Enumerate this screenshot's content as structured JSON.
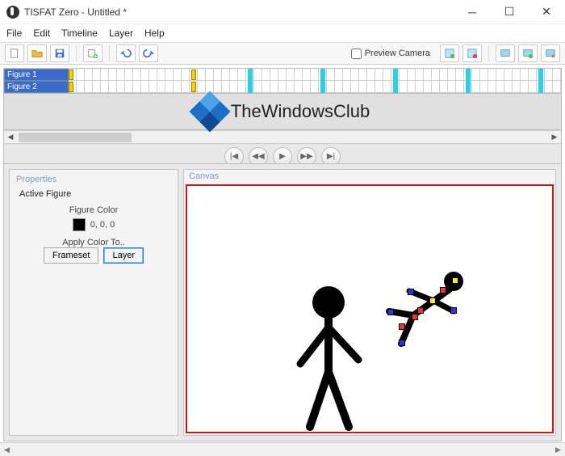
{
  "window": {
    "title": "TISFAT Zero - Untitled *"
  },
  "menu": {
    "items": [
      "File",
      "Edit",
      "Timeline",
      "Layer",
      "Help"
    ]
  },
  "toolbar": {
    "new": "new-file-icon",
    "open": "open-folder-icon",
    "save": "save-icon",
    "add_frame": "add-frame-icon",
    "undo": "undo-icon",
    "redo": "redo-icon",
    "preview_camera_label": "Preview Camera",
    "preview_camera_checked": false,
    "right_icons": [
      "add-object-icon",
      "remove-object-icon",
      "screen-a-icon",
      "screen-b-icon",
      "screen-c-icon"
    ]
  },
  "timeline": {
    "layers": [
      "Figure 1",
      "Figure 2"
    ]
  },
  "watermark": {
    "text": "TheWindowsClub"
  },
  "playback": {
    "buttons": [
      "first-frame",
      "prev-frame",
      "play",
      "next-frame",
      "last-frame"
    ]
  },
  "properties": {
    "panel_title": "Properties",
    "active_figure_label": "Active Figure",
    "figure_color_label": "Figure Color",
    "color_rgb": "0, 0, 0",
    "apply_label": "Apply Color To..",
    "frameset_btn": "Frameset",
    "layer_btn": "Layer"
  },
  "canvas": {
    "title": "Canvas"
  }
}
